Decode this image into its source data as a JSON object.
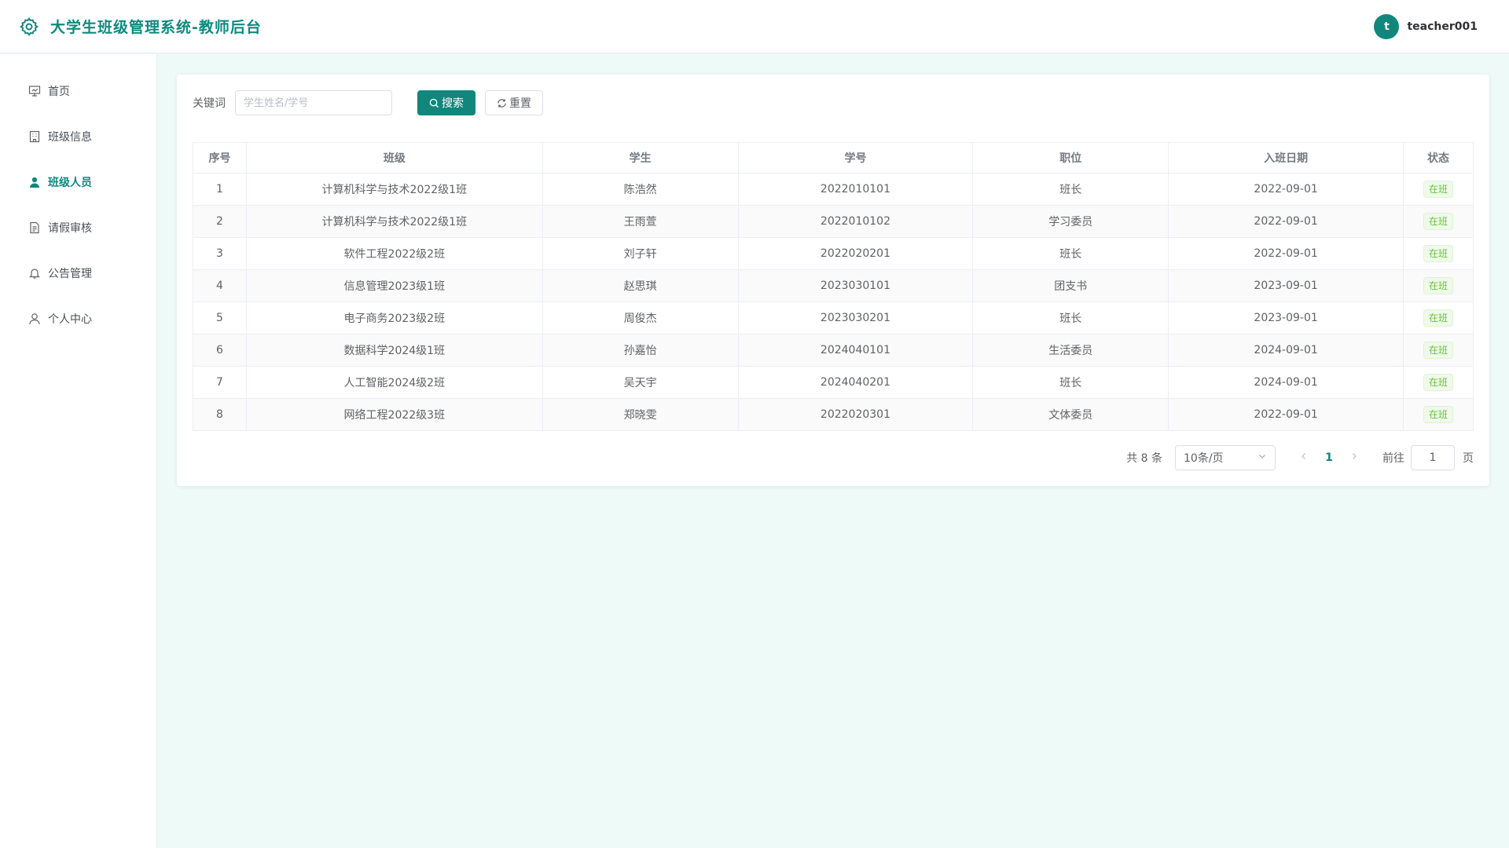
{
  "header": {
    "title": "大学生班级管理系统-教师后台",
    "avatar_letter": "t",
    "username": "teacher001"
  },
  "sidebar": {
    "items": [
      {
        "label": "首页",
        "icon": "presentation-icon",
        "active": false
      },
      {
        "label": "班级信息",
        "icon": "building-icon",
        "active": false
      },
      {
        "label": "班级人员",
        "icon": "user-icon",
        "active": true
      },
      {
        "label": "请假审核",
        "icon": "document-icon",
        "active": false
      },
      {
        "label": "公告管理",
        "icon": "bell-icon",
        "active": false
      },
      {
        "label": "个人中心",
        "icon": "user-outline-icon",
        "active": false
      }
    ]
  },
  "toolbar": {
    "keyword_label": "关键词",
    "search_placeholder": "学生姓名/学号",
    "search_value": "",
    "search_button": "搜索",
    "reset_button": "重置"
  },
  "table": {
    "headers": [
      "序号",
      "班级",
      "学生",
      "学号",
      "职位",
      "入班日期",
      "状态"
    ],
    "rows": [
      [
        "1",
        "计算机科学与技术2022级1班",
        "陈浩然",
        "2022010101",
        "班长",
        "2022-09-01",
        "在班"
      ],
      [
        "2",
        "计算机科学与技术2022级1班",
        "王雨萱",
        "2022010102",
        "学习委员",
        "2022-09-01",
        "在班"
      ],
      [
        "3",
        "软件工程2022级2班",
        "刘子轩",
        "2022020201",
        "班长",
        "2022-09-01",
        "在班"
      ],
      [
        "4",
        "信息管理2023级1班",
        "赵思琪",
        "2023030101",
        "团支书",
        "2023-09-01",
        "在班"
      ],
      [
        "5",
        "电子商务2023级2班",
        "周俊杰",
        "2023030201",
        "班长",
        "2023-09-01",
        "在班"
      ],
      [
        "6",
        "数据科学2024级1班",
        "孙嘉怡",
        "2024040101",
        "生活委员",
        "2024-09-01",
        "在班"
      ],
      [
        "7",
        "人工智能2024级2班",
        "吴天宇",
        "2024040201",
        "班长",
        "2024-09-01",
        "在班"
      ],
      [
        "8",
        "网络工程2022级3班",
        "郑晓雯",
        "2022020301",
        "文体委员",
        "2022-09-01",
        "在班"
      ]
    ]
  },
  "pager": {
    "total": "共 8 条",
    "page_size": "10条/页",
    "current_page": "1",
    "goto_label": "前往",
    "goto_value": "1",
    "page_suffix": "页"
  },
  "colors": {
    "accent": "#11877b",
    "status_green": "#67c23a"
  }
}
